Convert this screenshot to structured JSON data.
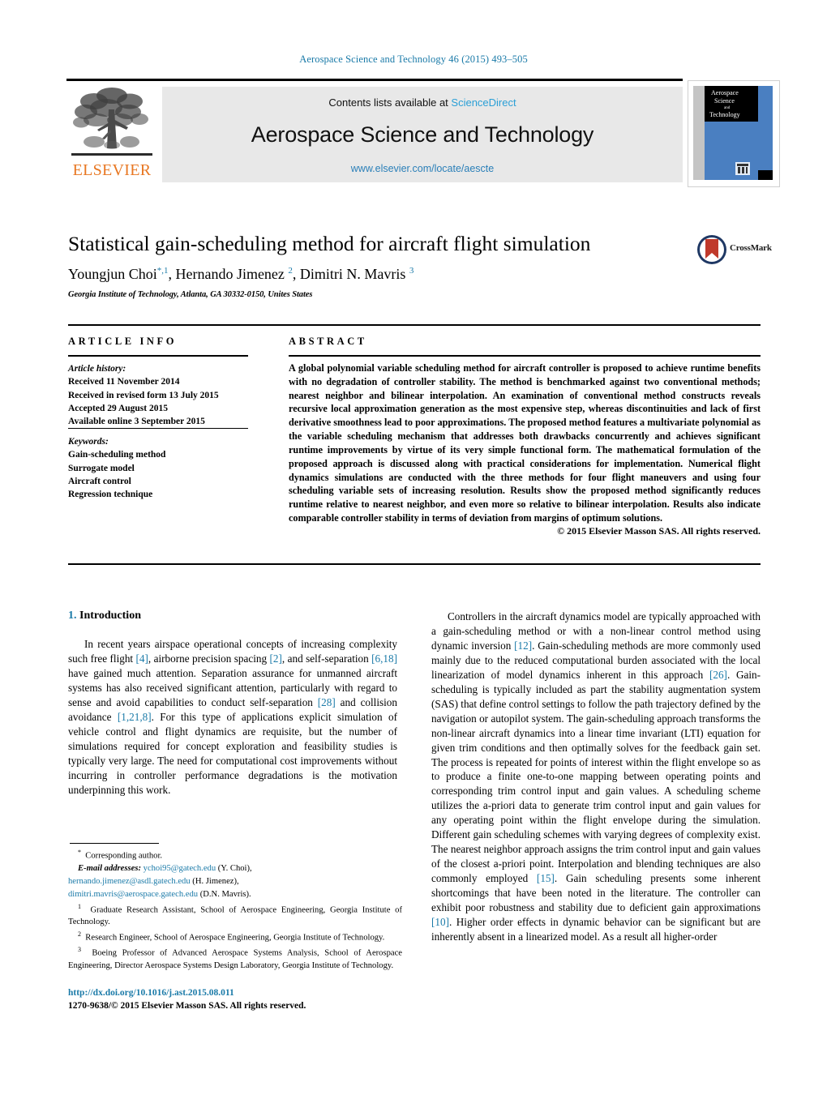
{
  "running_head": "Aerospace Science and Technology 46 (2015) 493–505",
  "masthead": {
    "contents_line": "Contents lists available at ",
    "sciencedirect": "ScienceDirect",
    "journal_title": "Aerospace Science and Technology",
    "journal_url": "www.elsevier.com/locate/aescte",
    "publisher_wordmark": "ELSEVIER",
    "cover_title_lines": [
      "Aerospace",
      "Science",
      "and",
      "Technology"
    ]
  },
  "article": {
    "title": "Statistical gain-scheduling method for aircraft flight simulation",
    "authors_html": "Youngjun Choi<sup class=\"star\">*,</sup><sup>1</sup>, Hernando Jimenez <sup>2</sup>, Dimitri N. Mavris <sup>3</sup>",
    "affiliation": "Georgia Institute of Technology, Atlanta, GA 30332-0150, Unites States",
    "crossmark_label": "CrossMark"
  },
  "info": {
    "heading": "ARTICLE INFO",
    "history_label": "Article history:",
    "history": [
      "Received 11 November 2014",
      "Received in revised form 13 July 2015",
      "Accepted 29 August 2015",
      "Available online 3 September 2015"
    ],
    "keywords_label": "Keywords:",
    "keywords": [
      "Gain-scheduling method",
      "Surrogate model",
      "Aircraft control",
      "Regression technique"
    ]
  },
  "abstract": {
    "heading": "ABSTRACT",
    "text": "A global polynomial variable scheduling method for aircraft controller is proposed to achieve runtime benefits with no degradation of controller stability. The method is benchmarked against two conventional methods; nearest neighbor and bilinear interpolation. An examination of conventional method constructs reveals recursive local approximation generation as the most expensive step, whereas discontinuities and lack of first derivative smoothness lead to poor approximations. The proposed method features a multivariate polynomial as the variable scheduling mechanism that addresses both drawbacks concurrently and achieves significant runtime improvements by virtue of its very simple functional form. The mathematical formulation of the proposed approach is discussed along with practical considerations for implementation. Numerical flight dynamics simulations are conducted with the three methods for four flight maneuvers and using four scheduling variable sets of increasing resolution. Results show the proposed method significantly reduces runtime relative to nearest neighbor, and even more so relative to bilinear interpolation. Results also indicate comparable controller stability in terms of deviation from margins of optimum solutions.",
    "copyright": "© 2015 Elsevier Masson SAS. All rights reserved."
  },
  "body": {
    "section_number": "1.",
    "section_title": "Introduction",
    "left_paragraph_html": "In recent years airspace operational concepts of increasing complexity such free flight <span class=\"cite\">[4]</span>, airborne precision spacing <span class=\"cite\">[2]</span>, and self-separation <span class=\"cite\">[6,18]</span> have gained much attention. Separation assurance for unmanned aircraft systems has also received significant attention, particularly with regard to sense and avoid capabilities to conduct self-separation <span class=\"cite\">[28]</span> and collision avoidance <span class=\"cite\">[1,21,8]</span>. For this type of applications explicit simulation of vehicle control and flight dynamics are requisite, but the number of simulations required for concept exploration and feasibility studies is typically very large. The need for computational cost improvements without incurring in controller performance degradations is the motivation underpinning this work.",
    "right_paragraph_html": "Controllers in the aircraft dynamics model are typically approached with a gain-scheduling method or with a non-linear control method using dynamic inversion <span class=\"cite\">[12]</span>. Gain-scheduling methods are more commonly used mainly due to the reduced computational burden associated with the local linearization of model dynamics inherent in this approach <span class=\"cite\">[26]</span>. Gain-scheduling is typically included as part the stability augmentation system (SAS) that define control settings to follow the path trajectory defined by the navigation or autopilot system. The gain-scheduling approach transforms the non-linear aircraft dynamics into a linear time invariant (LTI) equation for given trim conditions and then optimally solves for the feedback gain set. The process is repeated for points of interest within the flight envelope so as to produce a finite one-to-one mapping between operating points and corresponding trim control input and gain values. A scheduling scheme utilizes the a-priori data to generate trim control input and gain values for any operating point within the flight envelope during the simulation. Different gain scheduling schemes with varying degrees of complexity exist. The nearest neighbor approach assigns the trim control input and gain values of the closest a-priori point. Interpolation and blending techniques are also commonly employed <span class=\"cite\">[15]</span>. Gain scheduling presents some inherent shortcomings that have been noted in the literature. The controller can exhibit poor robustness and stability due to deficient gain approximations <span class=\"cite\">[10]</span>. Higher order effects in dynamic behavior can be significant but are inherently absent in a linearized model. As a result all higher-order"
  },
  "footnotes": {
    "corresponding_html": "<sup>*</sup>&nbsp; Corresponding author.",
    "emails_html": "<span class=\"em\">E-mail addresses:</span> <span class=\"mail\">ychoi95@gatech.edu</span> (Y. Choi),",
    "email_line2_html": "<span class=\"mail\">hernando.jimenez@asdl.gatech.edu</span> (H. Jimenez),",
    "email_line3_html": "<span class=\"mail\">dimitri.mavris@aerospace.gatech.edu</span> (D.N. Mavris).",
    "note1_html": "<sup>1</sup>&nbsp; Graduate Research Assistant, School of Aerospace Engineering, Georgia Institute of Technology.",
    "note2_html": "<sup>2</sup>&nbsp; Research Engineer, School of Aerospace Engineering, Georgia Institute of Technology.",
    "note3_html": "<sup>3</sup>&nbsp; Boeing Professor of Advanced Aerospace Systems Analysis, School of Aerospace Engineering, Director Aerospace Systems Design Laboratory, Georgia Institute of Technology."
  },
  "doi": {
    "url": "http://dx.doi.org/10.1016/j.ast.2015.08.011",
    "issn_line": "1270-9638/© 2015 Elsevier Masson SAS. All rights reserved."
  },
  "colors": {
    "link": "#1a7aa8",
    "sciencedirect": "#2a9fd6",
    "elsevier_orange": "#E87722",
    "banner_bg": "#e8e8e8",
    "cover_blue": "#4a7fc1"
  }
}
